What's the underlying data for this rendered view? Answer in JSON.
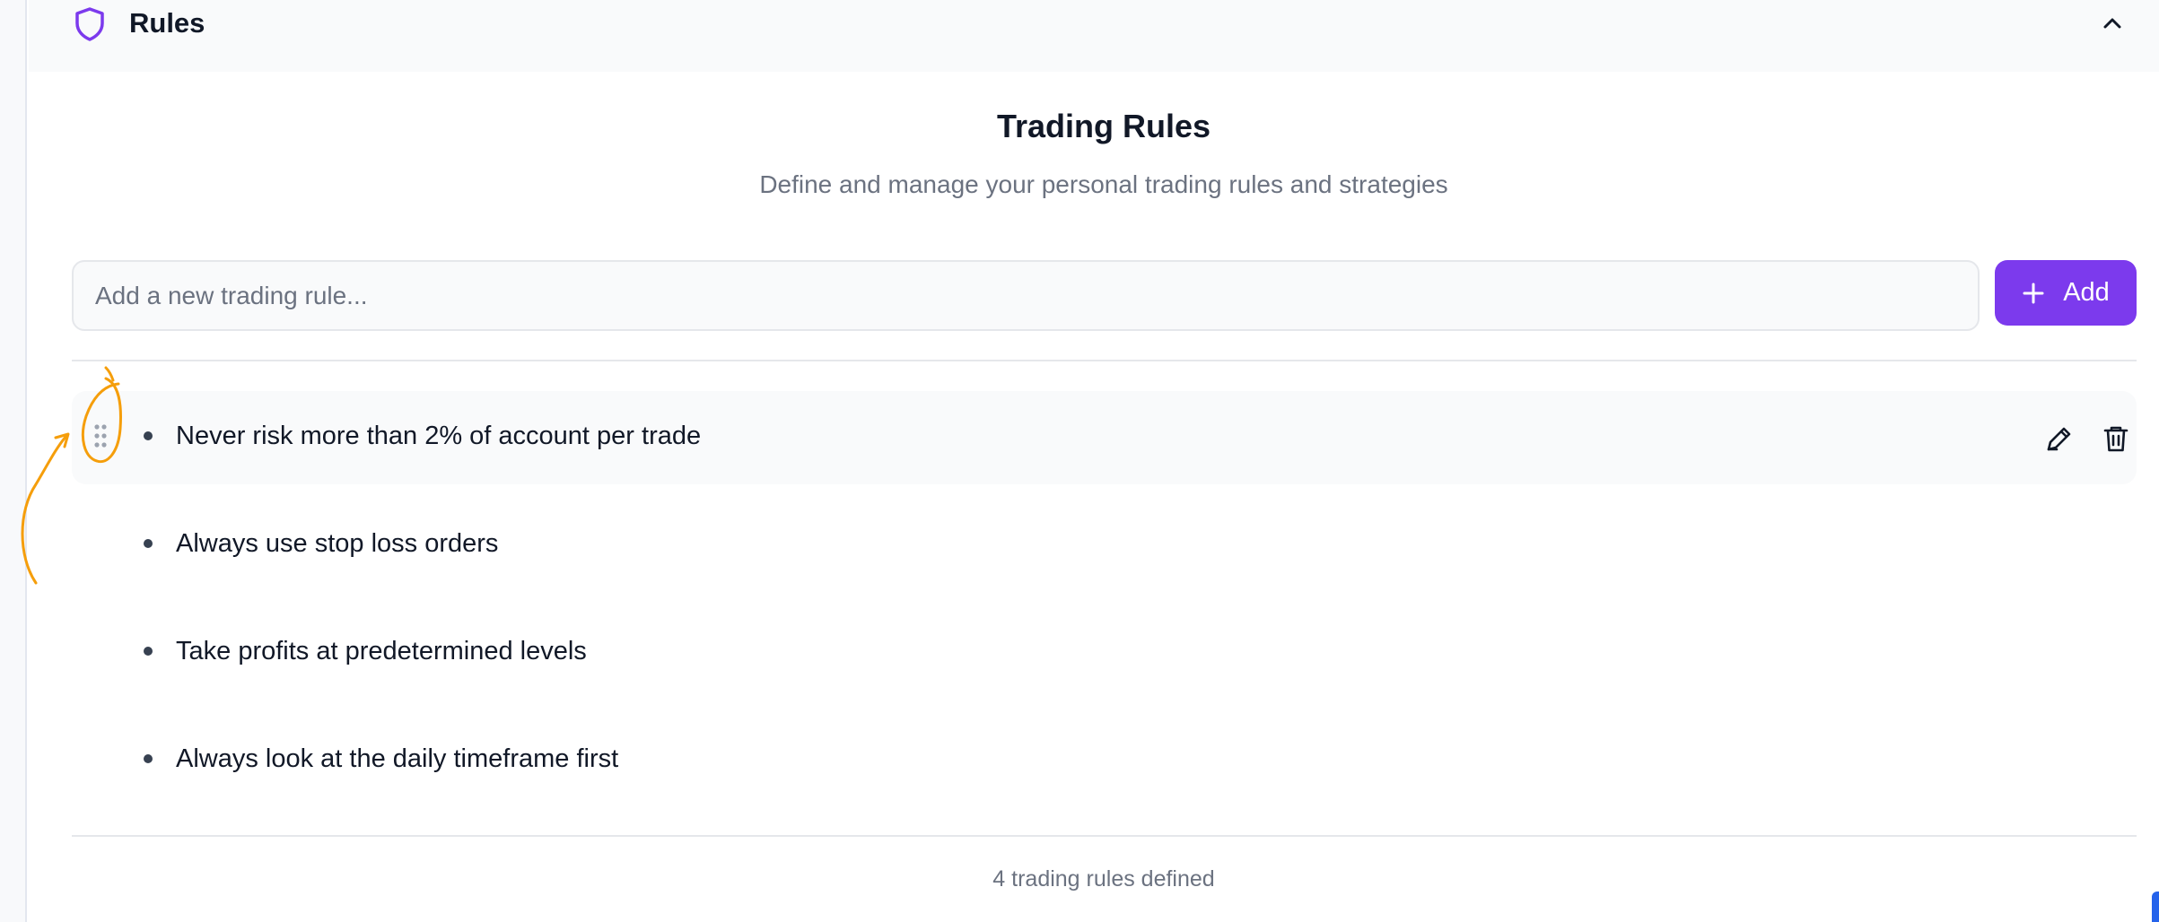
{
  "section": {
    "title": "Rules",
    "icon": "shield-icon",
    "collapse_icon": "chevron-up-icon"
  },
  "main": {
    "title": "Trading Rules",
    "subtitle": "Define and manage your personal trading rules and strategies"
  },
  "new_rule": {
    "placeholder": "Add a new trading rule...",
    "value": "",
    "add_label": "Add"
  },
  "rules": [
    {
      "text": "Never risk more than 2% of account per trade"
    },
    {
      "text": "Always use stop loss orders"
    },
    {
      "text": "Take profits at predetermined levels"
    },
    {
      "text": "Always look at the daily timeframe first"
    }
  ],
  "footer": {
    "count_text": "4 trading rules defined"
  },
  "colors": {
    "accent": "#7c3aed",
    "annotation": "#f59e0b",
    "text": "#111827",
    "muted": "#6b7280"
  }
}
